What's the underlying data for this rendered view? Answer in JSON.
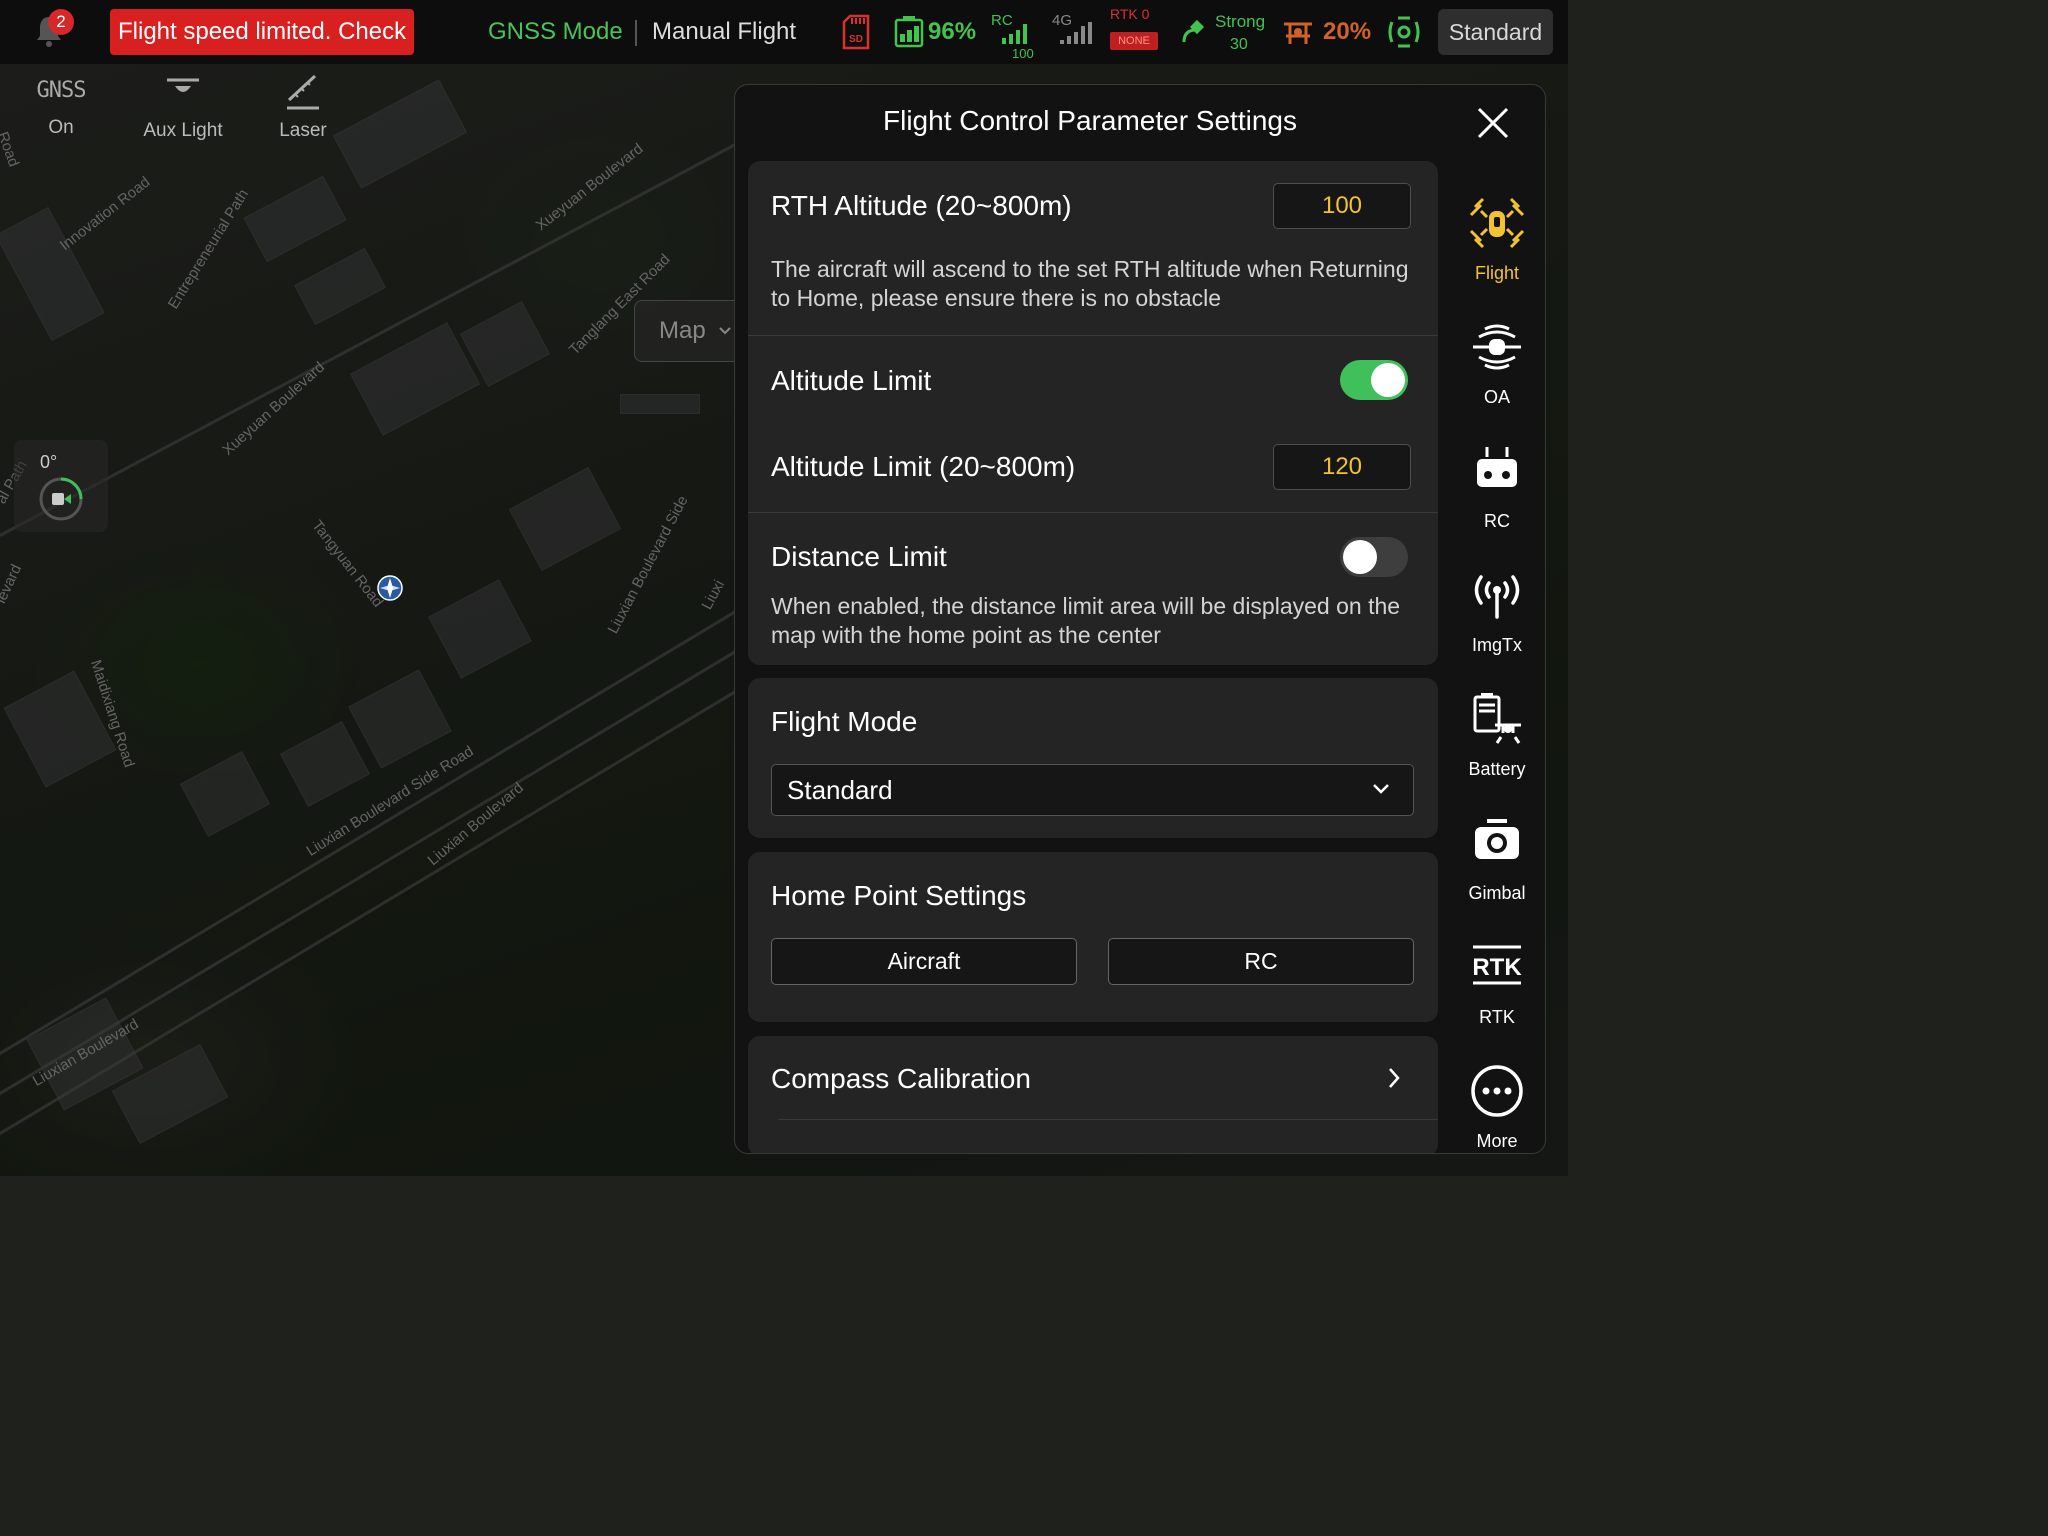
{
  "topbar": {
    "notification_count": "2",
    "warning_text": "Flight speed limited. Check",
    "gnss_mode": "GNSS Mode",
    "flight_mode": "Manual Flight",
    "sd_label": "SD",
    "aircraft_battery": "96%",
    "rc_label": "RC",
    "rc_value": "100",
    "net_label": "4G",
    "rtk_label": "RTK 0",
    "rtk_status": "NONE",
    "gps_strength": "Strong",
    "gps_sats": "30",
    "rc_battery": "20%",
    "mode_pill": "Standard"
  },
  "tools": {
    "gnss_label": "GNSS",
    "gnss_state": "On",
    "aux_light": "Aux Light",
    "laser": "Laser"
  },
  "map": {
    "layer_button": "Map",
    "heading": "0°",
    "roads": [
      "Road",
      "Innovation Road",
      "Entrepreneurial Path",
      "Xueyuan Boulevard",
      "Tanglang East Road",
      "Xueyuan Boulevard",
      "Tangyuan Road",
      "Liuxian Boulevard Side",
      "Liuxi",
      "Maidixiang Road",
      "Liuxian Boulevard Side Road",
      "Liuxian Boulevard",
      "Liuxian Boulevard",
      "levard",
      "al Path"
    ]
  },
  "panel": {
    "title": "Flight Control Parameter Settings",
    "rth_label": "RTH Altitude (20~800m)",
    "rth_value": "100",
    "rth_desc": "The aircraft will ascend to the set RTH altitude when Returning to Home, please ensure there is no obstacle",
    "alt_limit_label": "Altitude Limit",
    "alt_limit_enabled": true,
    "alt_limit_value_label": "Altitude Limit (20~800m)",
    "alt_limit_value": "120",
    "dist_limit_label": "Distance Limit",
    "dist_limit_enabled": false,
    "dist_limit_desc": "When enabled, the distance limit area will be displayed on the map with the home point as the center",
    "flight_mode_label": "Flight Mode",
    "flight_mode_value": "Standard",
    "home_point_label": "Home Point Settings",
    "home_aircraft": "Aircraft",
    "home_rc": "RC",
    "compass_label": "Compass Calibration"
  },
  "nav": [
    {
      "label": "Flight",
      "icon": "drone-icon",
      "active": true
    },
    {
      "label": "OA",
      "icon": "obstacle-avoidance-icon",
      "active": false
    },
    {
      "label": "RC",
      "icon": "remote-controller-icon",
      "active": false
    },
    {
      "label": "ImgTx",
      "icon": "antenna-icon",
      "active": false
    },
    {
      "label": "Battery",
      "icon": "battery-icon",
      "active": false
    },
    {
      "label": "Gimbal",
      "icon": "camera-icon",
      "active": false
    },
    {
      "label": "RTK",
      "icon": "rtk-icon",
      "active": false
    },
    {
      "label": "More",
      "icon": "more-icon",
      "active": false
    }
  ],
  "colors": {
    "accent": "#f2c230",
    "toggle_on": "#3fc05a",
    "warning": "#d82020",
    "status_green": "#43c24f"
  }
}
